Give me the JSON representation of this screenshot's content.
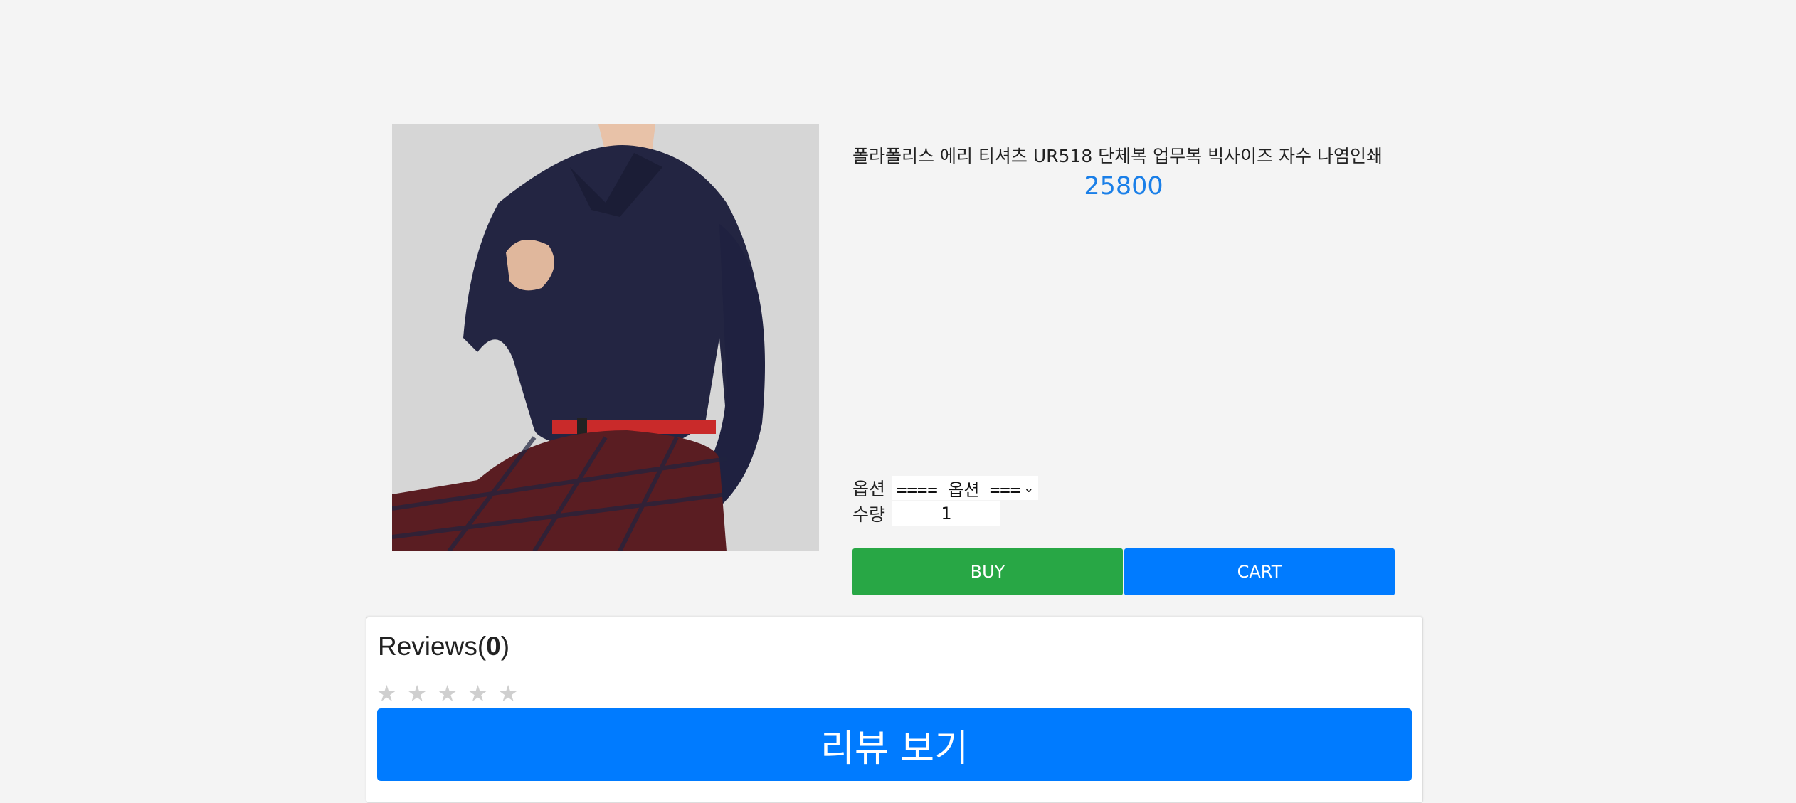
{
  "product": {
    "title": "폴라폴리스 에리 티셔츠 UR518 단체복 업무복 빅사이즈 자수 나염인쇄",
    "price": "25800",
    "image_alt": "product-photo"
  },
  "form": {
    "option_label": "옵션",
    "option_selected": "==== 옵션 ===",
    "quantity_label": "수량",
    "quantity_value": "1"
  },
  "actions": {
    "buy_label": "BUY",
    "cart_label": "CART"
  },
  "reviews": {
    "heading_prefix": "Reviews(",
    "count": "0",
    "heading_suffix": ")",
    "star_glyph": "★",
    "view_button_label": "리뷰 보기"
  },
  "colors": {
    "price": "#1a7fe8",
    "buy": "#28a745",
    "cart": "#007bff",
    "view_reviews": "#007bff"
  }
}
